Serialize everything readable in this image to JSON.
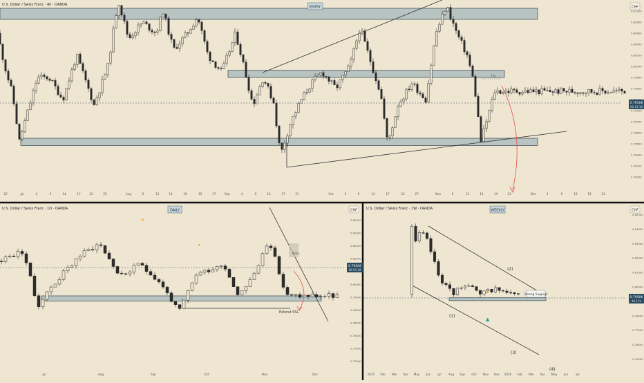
{
  "colors": {
    "background": "#efe6d2",
    "zone_fill": "#aebfbf",
    "zone_stroke": "#2b3d4a",
    "candle": "#2b2b2b",
    "separator": "#111111",
    "price_tag": "#2a4a5f",
    "arrow": "#e0605a",
    "marker_orange": "#f0a020",
    "marker_teal": "#2a9d8f"
  },
  "panels": {
    "h4": {
      "symbol": "U.S. Dollar / Swiss Franc · 4h · OANDA",
      "tag": "ENTRY",
      "currency": "CHF",
      "price_tag": {
        "price": "0.79506",
        "timer": "02:23:18"
      },
      "zone_note": "1%",
      "y_ticks": [
        "0.81000",
        "0.80800",
        "0.80600",
        "0.80400",
        "0.80200",
        "0.80000",
        "0.79800",
        "0.79600",
        "0.79400",
        "0.79200",
        "0.79000",
        "0.78800",
        "0.78600",
        "0.78400",
        "0.78200",
        "0.78000"
      ],
      "x_ticks": [
        "26",
        "Jul",
        "4",
        "9",
        "14",
        "17",
        "22",
        "25",
        "Aug",
        "6",
        "11",
        "14",
        "19",
        "22",
        "27",
        "Sep",
        "4",
        "9",
        "12",
        "17",
        "21",
        "Oct",
        "5",
        "9",
        "14",
        "17",
        "22",
        "27",
        "Nov",
        "6",
        "11",
        "14",
        "19",
        "23",
        "Dec",
        "4",
        "9",
        "13",
        "18",
        "23"
      ]
    },
    "daily": {
      "symbol": "U.S. Dollar / Swiss Franc · 1D · OANDA",
      "tag": "DAILY",
      "currency": "CHF",
      "price_tag": {
        "price": "0.79506",
        "timer": "06:55:18"
      },
      "note": "Extend SSL",
      "zone_note": "Note",
      "y_ticks": [
        "0.82500",
        "0.82000",
        "0.81500",
        "0.81000",
        "0.80500",
        "0.80000",
        "0.79500",
        "0.79000",
        "0.78500",
        "0.78000",
        "0.77500",
        "0.77000"
      ],
      "x_ticks": [
        "Jul",
        "Aug",
        "Sep",
        "Oct",
        "Nov",
        "Dec"
      ]
    },
    "weekly": {
      "symbol": "U.S. Dollar / Swiss Franc · 1W · OANDA",
      "tag": "WEEKLY",
      "currency": "CHF",
      "price_tag": {
        "price": "0.79506",
        "timer": "4d 17h"
      },
      "label_support": "Strong Support",
      "wave_labels": [
        "(1)",
        "(2)",
        "(3)",
        "(4)"
      ],
      "y_ticks": [
        "0.85000",
        "0.84000",
        "0.83000",
        "0.82000",
        "0.81000",
        "0.80000",
        "0.79000",
        "0.78000",
        "0.77000",
        "0.76000",
        "0.75000"
      ],
      "x_ticks": [
        "2025",
        "Feb",
        "Mar",
        "Apr",
        "May",
        "Jun",
        "Jul",
        "Aug",
        "Sep",
        "Oct",
        "Nov",
        "Dec",
        "2026",
        "Feb",
        "Mar",
        "Apr",
        "May",
        "Jun",
        "Jul"
      ]
    }
  },
  "chart_data": [
    {
      "type": "candlestick",
      "title": "U.S. Dollar / Swiss Franc · 4h · OANDA",
      "ylim": [
        0.778,
        0.812
      ],
      "zones": [
        [
          0.8085,
          0.8105
        ],
        [
          0.798,
          0.7993
        ],
        [
          0.7857,
          0.787
        ]
      ],
      "current_price": 0.79506,
      "path": [
        [
          0,
          0.806
        ],
        [
          12,
          0.7995
        ],
        [
          22,
          0.795
        ],
        [
          32,
          0.7865
        ],
        [
          48,
          0.7935
        ],
        [
          58,
          0.798
        ],
        [
          75,
          0.798
        ],
        [
          95,
          0.794
        ],
        [
          115,
          0.802
        ],
        [
          140,
          0.793
        ],
        [
          160,
          0.8
        ],
        [
          175,
          0.812
        ],
        [
          190,
          0.805
        ],
        [
          210,
          0.808
        ],
        [
          230,
          0.806
        ],
        [
          240,
          0.81
        ],
        [
          255,
          0.803
        ],
        [
          275,
          0.806
        ],
        [
          290,
          0.809
        ],
        [
          305,
          0.802
        ],
        [
          325,
          0.799
        ],
        [
          345,
          0.806
        ],
        [
          355,
          0.801
        ],
        [
          370,
          0.793
        ],
        [
          385,
          0.798
        ],
        [
          400,
          0.7935
        ],
        [
          410,
          0.784
        ],
        [
          425,
          0.79
        ],
        [
          440,
          0.794
        ],
        [
          455,
          0.797
        ],
        [
          470,
          0.799
        ],
        [
          490,
          0.796
        ],
        [
          510,
          0.8
        ],
        [
          525,
          0.807
        ],
        [
          540,
          0.801
        ],
        [
          555,
          0.795
        ],
        [
          565,
          0.786
        ],
        [
          580,
          0.793
        ],
        [
          600,
          0.797
        ],
        [
          620,
          0.794
        ],
        [
          635,
          0.806
        ],
        [
          650,
          0.811
        ],
        [
          665,
          0.806
        ],
        [
          680,
          0.802
        ],
        [
          690,
          0.797
        ],
        [
          700,
          0.7865
        ],
        [
          710,
          0.791
        ],
        [
          720,
          0.7955
        ]
      ]
    },
    {
      "type": "candlestick",
      "title": "U.S. Dollar / Swiss Franc · 1D · OANDA",
      "ylim": [
        0.768,
        0.83
      ],
      "zones": [
        [
          0.7935,
          0.7955
        ]
      ],
      "current_price": 0.79506,
      "path": [
        [
          2,
          0.809
        ],
        [
          40,
          0.813
        ],
        [
          60,
          0.7915
        ],
        [
          80,
          0.799
        ],
        [
          120,
          0.811
        ],
        [
          150,
          0.816
        ],
        [
          180,
          0.803
        ],
        [
          210,
          0.808
        ],
        [
          240,
          0.8
        ],
        [
          265,
          0.789
        ],
        [
          290,
          0.804
        ],
        [
          330,
          0.808
        ],
        [
          350,
          0.796
        ],
        [
          375,
          0.804
        ],
        [
          395,
          0.818
        ],
        [
          420,
          0.7955
        ]
      ]
    },
    {
      "type": "candlestick",
      "title": "U.S. Dollar / Swiss Franc · 1W · OANDA",
      "ylim": [
        0.745,
        0.855
      ],
      "zones": [
        [
          0.7905,
          0.7925
        ]
      ],
      "current_price": 0.79506,
      "path": [
        [
          598,
          0.85
        ],
        [
          606,
          0.83
        ],
        [
          615,
          0.838
        ],
        [
          625,
          0.831
        ],
        [
          640,
          0.808
        ],
        [
          660,
          0.795
        ],
        [
          680,
          0.803
        ],
        [
          700,
          0.794
        ],
        [
          720,
          0.799
        ],
        [
          745,
          0.795
        ]
      ]
    }
  ]
}
